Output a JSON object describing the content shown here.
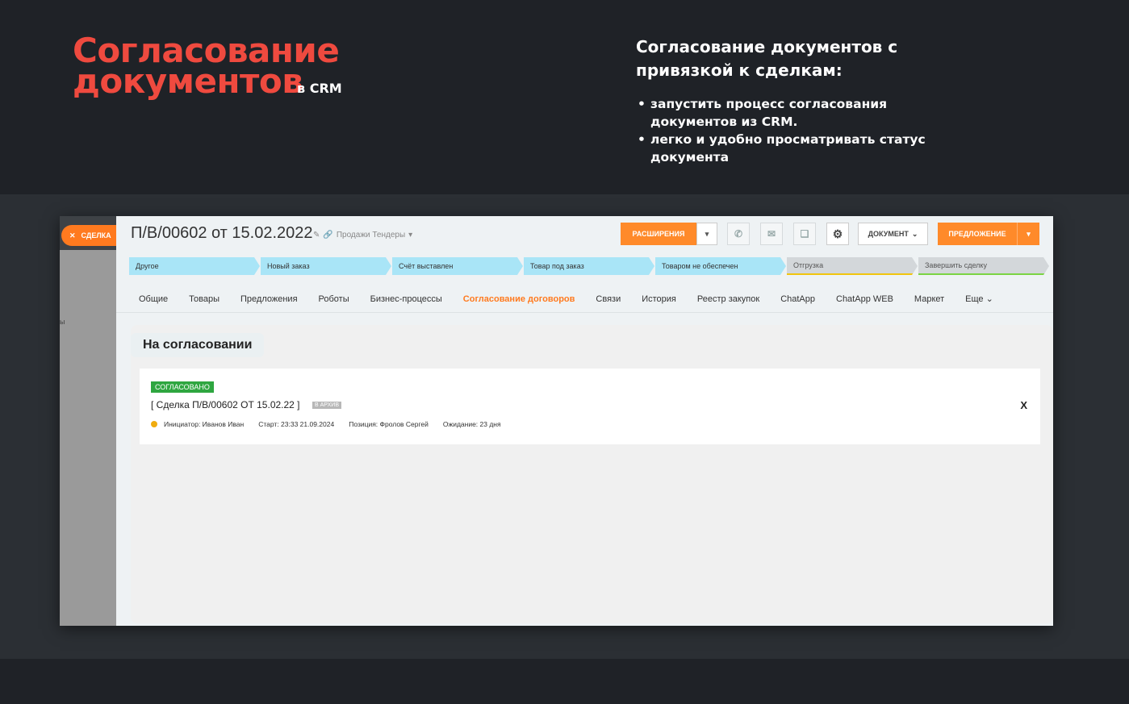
{
  "hero": {
    "title_line1": "Согласование",
    "title_line2": "документов",
    "subtitle": "в CRM"
  },
  "intro": {
    "heading": "Согласование документов с привязкой к сделкам:",
    "bullets": [
      "запустить процесс согласования документов из CRM.",
      "легко и удобно просматривать статус документа"
    ]
  },
  "sidebar": {
    "close_label": "СДЕЛКА",
    "stray_text": "ы"
  },
  "deal": {
    "title": "П/В/00602  от  15.02.2022",
    "category": "Продажи Тендеры"
  },
  "toolbar": {
    "extensions": "РАСШИРЕНИЯ",
    "document": "ДОКУМЕНТ",
    "offer": "ПРЕДЛОЖЕНИЕ"
  },
  "pipeline": [
    {
      "label": "Другое",
      "state": "active"
    },
    {
      "label": "Новый заказ",
      "state": "active"
    },
    {
      "label": "Счёт выставлен",
      "state": "active"
    },
    {
      "label": "Товар под заказ",
      "state": "active"
    },
    {
      "label": "Товаром не обеспечен",
      "state": "active"
    },
    {
      "label": "Отгрузка",
      "state": "inactive"
    },
    {
      "label": "Завершить сделку",
      "state": "final"
    }
  ],
  "tabs": [
    {
      "label": "Общие"
    },
    {
      "label": "Товары"
    },
    {
      "label": "Предложения"
    },
    {
      "label": "Роботы"
    },
    {
      "label": "Бизнес-процессы"
    },
    {
      "label": "Согласование договоров"
    },
    {
      "label": "Связи"
    },
    {
      "label": "История"
    },
    {
      "label": "Реестр закупок"
    },
    {
      "label": "ChatApp"
    },
    {
      "label": "ChatApp WEB"
    },
    {
      "label": "Маркет"
    },
    {
      "label": "Еще"
    }
  ],
  "active_tab": "Согласование договоров",
  "panel": {
    "heading": "На согласовании",
    "status_badge": "СОГЛАСОВАНО",
    "doc_title": "[ Сделка П/В/00602 ОТ 15.02.22 ]",
    "archive_badge": "В АРХИВ",
    "close": "X",
    "initiator": "Инициатор: Иванов Иван",
    "start": "Старт: 23:33 21.09.2024",
    "position": "Позиция: Фролов Сергей",
    "waiting": "Ожидание: 23 дня"
  },
  "colors": {
    "accent": "#ef4a3f",
    "orange": "#ff8a2a",
    "approved": "#2ea640",
    "stage_active": "#a9e5f7"
  }
}
